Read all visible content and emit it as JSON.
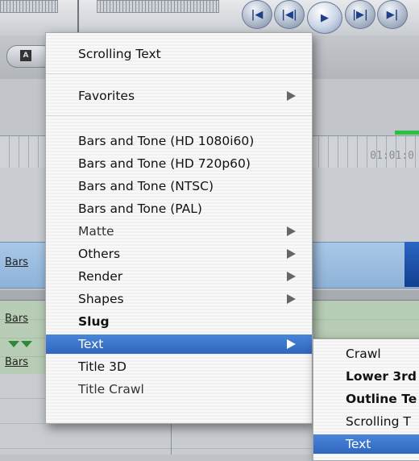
{
  "timeline": {
    "timecode": "01:01:0",
    "clip_labels": [
      "Bars",
      "Bars",
      "Bars"
    ]
  },
  "menu": {
    "items": [
      {
        "label": "Scrolling Text",
        "submenu": false,
        "selected": false
      },
      {
        "label": "Favorites",
        "submenu": true,
        "selected": false
      },
      {
        "label": "Bars and Tone (HD 1080i60)",
        "submenu": false,
        "selected": false
      },
      {
        "label": "Bars and Tone (HD 720p60)",
        "submenu": false,
        "selected": false
      },
      {
        "label": "Bars and Tone (NTSC)",
        "submenu": false,
        "selected": false
      },
      {
        "label": "Bars and Tone (PAL)",
        "submenu": false,
        "selected": false
      },
      {
        "label": "Matte",
        "submenu": true,
        "selected": false
      },
      {
        "label": "Others",
        "submenu": true,
        "selected": false
      },
      {
        "label": "Render",
        "submenu": true,
        "selected": false
      },
      {
        "label": "Shapes",
        "submenu": true,
        "selected": false
      },
      {
        "label": "Slug",
        "submenu": false,
        "selected": false
      },
      {
        "label": "Text",
        "submenu": true,
        "selected": true
      },
      {
        "label": "Title 3D",
        "submenu": false,
        "selected": false
      },
      {
        "label": "Title Crawl",
        "submenu": false,
        "selected": false
      }
    ]
  },
  "submenu": {
    "items": [
      {
        "label": "Crawl",
        "selected": false
      },
      {
        "label": "Lower 3rd",
        "selected": false
      },
      {
        "label": "Outline Te",
        "selected": false
      },
      {
        "label": "Scrolling T",
        "selected": false
      },
      {
        "label": "Text",
        "selected": true
      }
    ]
  },
  "colors": {
    "selection": "#3a73cc",
    "clip_blue": "#9dbde0",
    "clip_green": "#b3c9b0",
    "indicator_green": "#27c241"
  },
  "icons": [
    "text-generator-icon",
    "go-to-start-icon",
    "previous-edit-icon",
    "play-icon",
    "next-edit-icon",
    "go-to-end-icon",
    "submenu-arrow-icon"
  ]
}
